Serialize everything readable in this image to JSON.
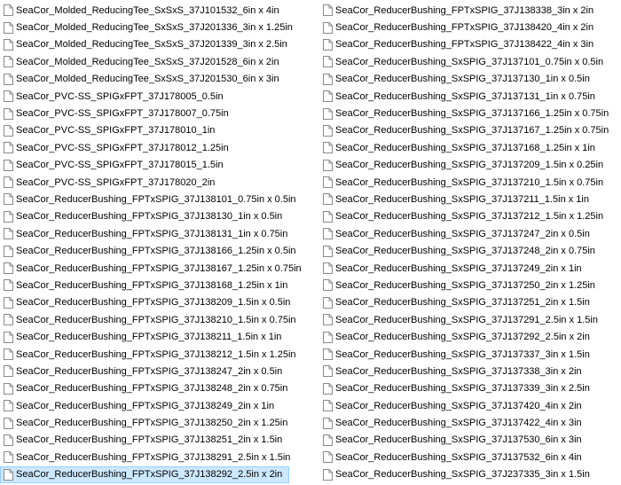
{
  "columns": [
    {
      "items": [
        "SeaCor_Molded_ReducingTee_SxSxS_37J101532_6in x 4in",
        "SeaCor_Molded_ReducingTee_SxSxS_37J201336_3in x 1.25in",
        "SeaCor_Molded_ReducingTee_SxSxS_37J201339_3in x 2.5in",
        "SeaCor_Molded_ReducingTee_SxSxS_37J201528_6in x 2in",
        "SeaCor_Molded_ReducingTee_SxSxS_37J201530_6in x 3in",
        "SeaCor_PVC-SS_SPIGxFPT_37J178005_0.5in",
        "SeaCor_PVC-SS_SPIGxFPT_37J178007_0.75in",
        "SeaCor_PVC-SS_SPIGxFPT_37J178010_1in",
        "SeaCor_PVC-SS_SPIGxFPT_37J178012_1.25in",
        "SeaCor_PVC-SS_SPIGxFPT_37J178015_1.5in",
        "SeaCor_PVC-SS_SPIGxFPT_37J178020_2in",
        "SeaCor_ReducerBushing_FPTxSPIG_37J138101_0.75in x 0.5in",
        "SeaCor_ReducerBushing_FPTxSPIG_37J138130_1in x 0.5in",
        "SeaCor_ReducerBushing_FPTxSPIG_37J138131_1in x 0.75in",
        "SeaCor_ReducerBushing_FPTxSPIG_37J138166_1.25in x 0.5in",
        "SeaCor_ReducerBushing_FPTxSPIG_37J138167_1.25in x 0.75in",
        "SeaCor_ReducerBushing_FPTxSPIG_37J138168_1.25in x 1in",
        "SeaCor_ReducerBushing_FPTxSPIG_37J138209_1.5in x 0.5in",
        "SeaCor_ReducerBushing_FPTxSPIG_37J138210_1.5in x 0.75in",
        "SeaCor_ReducerBushing_FPTxSPIG_37J138211_1.5in x 1in",
        "SeaCor_ReducerBushing_FPTxSPIG_37J138212_1.5in x 1.25in",
        "SeaCor_ReducerBushing_FPTxSPIG_37J138247_2in x 0.5in",
        "SeaCor_ReducerBushing_FPTxSPIG_37J138248_2in x 0.75in",
        "SeaCor_ReducerBushing_FPTxSPIG_37J138249_2in x 1in",
        "SeaCor_ReducerBushing_FPTxSPIG_37J138250_2in x 1.25in",
        "SeaCor_ReducerBushing_FPTxSPIG_37J138251_2in x 1.5in",
        "SeaCor_ReducerBushing_FPTxSPIG_37J138291_2.5in x 1.5in",
        "SeaCor_ReducerBushing_FPTxSPIG_37J138292_2.5in x 2in"
      ]
    },
    {
      "items": [
        "SeaCor_ReducerBushing_FPTxSPIG_37J138338_3in x 2in",
        "SeaCor_ReducerBushing_FPTxSPIG_37J138420_4in x 2in",
        "SeaCor_ReducerBushing_FPTxSPIG_37J138422_4in x 3in",
        "SeaCor_ReducerBushing_SxSPIG_37J137101_0.75in x 0.5in",
        "SeaCor_ReducerBushing_SxSPIG_37J137130_1in x 0.5in",
        "SeaCor_ReducerBushing_SxSPIG_37J137131_1in x 0.75in",
        "SeaCor_ReducerBushing_SxSPIG_37J137166_1.25in x 0.75in",
        "SeaCor_ReducerBushing_SxSPIG_37J137167_1.25in x 0.75in",
        "SeaCor_ReducerBushing_SxSPIG_37J137168_1.25in x 1in",
        "SeaCor_ReducerBushing_SxSPIG_37J137209_1.5in x 0.25in",
        "SeaCor_ReducerBushing_SxSPIG_37J137210_1.5in x 0.75in",
        "SeaCor_ReducerBushing_SxSPIG_37J137211_1.5in x 1in",
        "SeaCor_ReducerBushing_SxSPIG_37J137212_1.5in x 1.25in",
        "SeaCor_ReducerBushing_SxSPIG_37J137247_2in x 0.5in",
        "SeaCor_ReducerBushing_SxSPIG_37J137248_2in x 0.75in",
        "SeaCor_ReducerBushing_SxSPIG_37J137249_2in x 1in",
        "SeaCor_ReducerBushing_SxSPIG_37J137250_2in x 1.25in",
        "SeaCor_ReducerBushing_SxSPIG_37J137251_2in x 1.5in",
        "SeaCor_ReducerBushing_SxSPIG_37J137291_2.5in x 1.5in",
        "SeaCor_ReducerBushing_SxSPIG_37J137292_2.5in x 2in",
        "SeaCor_ReducerBushing_SxSPIG_37J137337_3in x 1.5in",
        "SeaCor_ReducerBushing_SxSPIG_37J137338_3in x 2in",
        "SeaCor_ReducerBushing_SxSPIG_37J137339_3in x 2.5in",
        "SeaCor_ReducerBushing_SxSPIG_37J137420_4in x 2in",
        "SeaCor_ReducerBushing_SxSPIG_37J137422_4in x 3in",
        "SeaCor_ReducerBushing_SxSPIG_37J137530_6in x 3in",
        "SeaCor_ReducerBushing_SxSPIG_37J137532_6in x 4in",
        "SeaCor_ReducerBushing_SxSPIG_37J237335_3in x 1.5in"
      ]
    }
  ],
  "selected": {
    "column": 0,
    "index": 27
  },
  "icon": "file-icon",
  "colors": {
    "selection_bg": "#cce8ff",
    "selection_border": "#99d1ff",
    "icon_outline": "#8a8a8a"
  }
}
